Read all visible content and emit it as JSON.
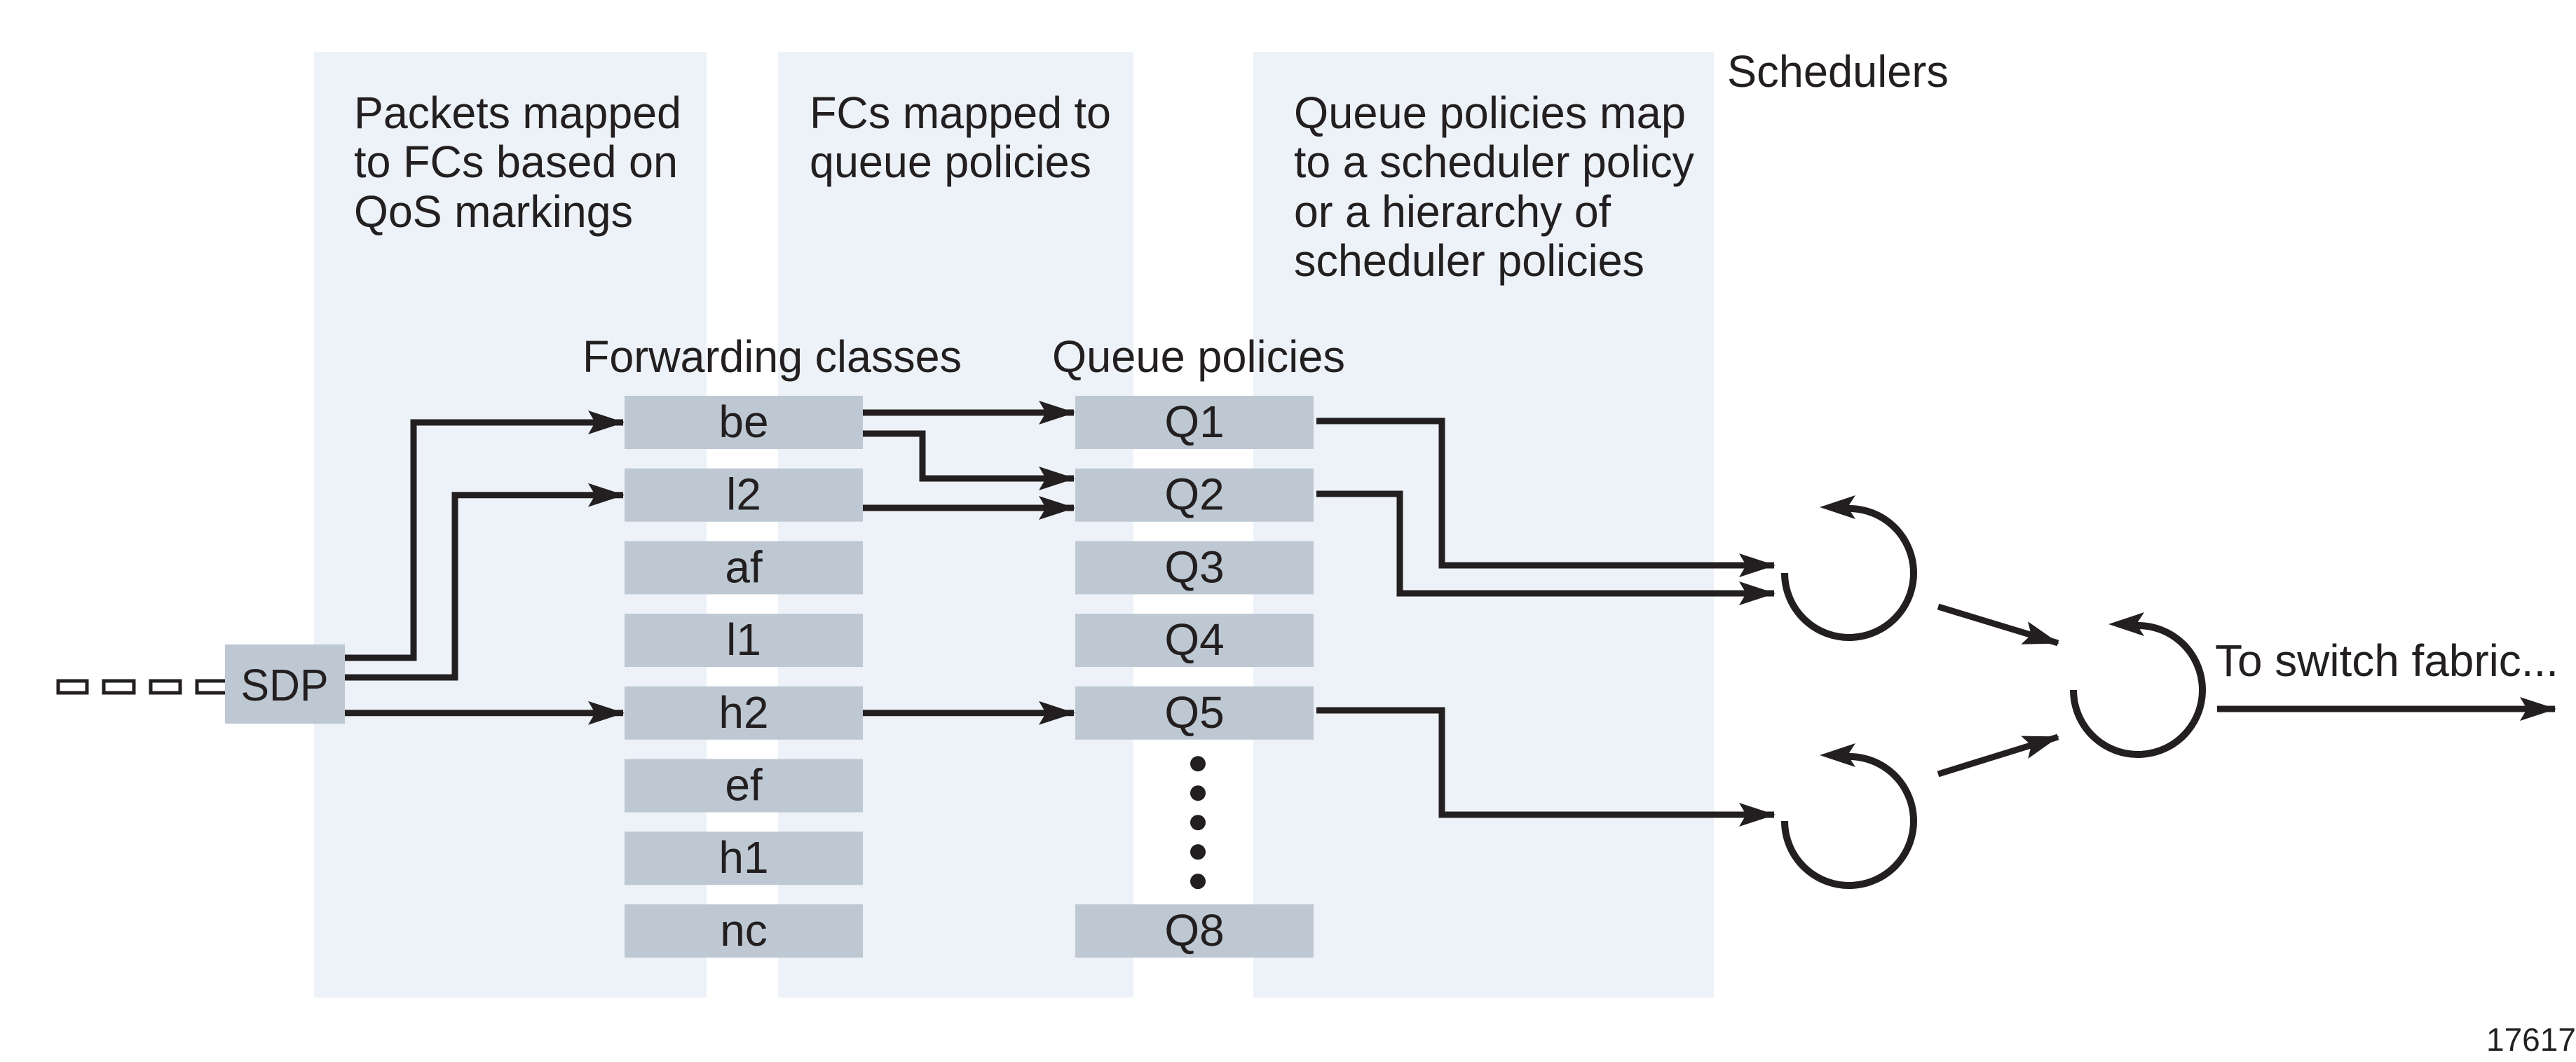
{
  "figure_id": "17617",
  "columns": [
    {
      "heading_lines": [
        "Packets mapped",
        "to FCs based on",
        "QoS markings"
      ]
    },
    {
      "heading_lines": [
        "FCs mapped to",
        "queue policies"
      ]
    },
    {
      "heading_lines": [
        "Queue policies map",
        "to a scheduler policy",
        "or a hierarchy of",
        "scheduler policies"
      ]
    }
  ],
  "schedulers_label": "Schedulers",
  "forwarding_classes_label": "Forwarding classes",
  "queue_policies_label": "Queue policies",
  "source": {
    "label": "SDP"
  },
  "forwarding_classes": [
    "be",
    "l2",
    "af",
    "l1",
    "h2",
    "ef",
    "h1",
    "nc"
  ],
  "queues": [
    {
      "label": "Q1",
      "slot": 0
    },
    {
      "label": "Q2",
      "slot": 1
    },
    {
      "label": "Q3",
      "slot": 2
    },
    {
      "label": "Q4",
      "slot": 3
    },
    {
      "label": "Q5",
      "slot": 4
    },
    {
      "label": "Q8",
      "slot": 7
    }
  ],
  "ellipsis_between": [
    "Q5",
    "Q8"
  ],
  "sdp_to_fc": [
    "be",
    "l2",
    "h2"
  ],
  "fc_to_queue": [
    {
      "from": "be",
      "to": "Q1"
    },
    {
      "from": "be",
      "to": "Q2"
    },
    {
      "from": "l2",
      "to": "Q2"
    },
    {
      "from": "h2",
      "to": "Q5"
    }
  ],
  "schedulers": [
    {
      "id": "sched-1",
      "inputs": [
        "Q1",
        "Q2"
      ]
    },
    {
      "id": "sched-2",
      "inputs": [
        "Q5"
      ]
    },
    {
      "id": "sched-root",
      "inputs": [
        "sched-1",
        "sched-2"
      ]
    }
  ],
  "output_label": "To switch fabric..."
}
